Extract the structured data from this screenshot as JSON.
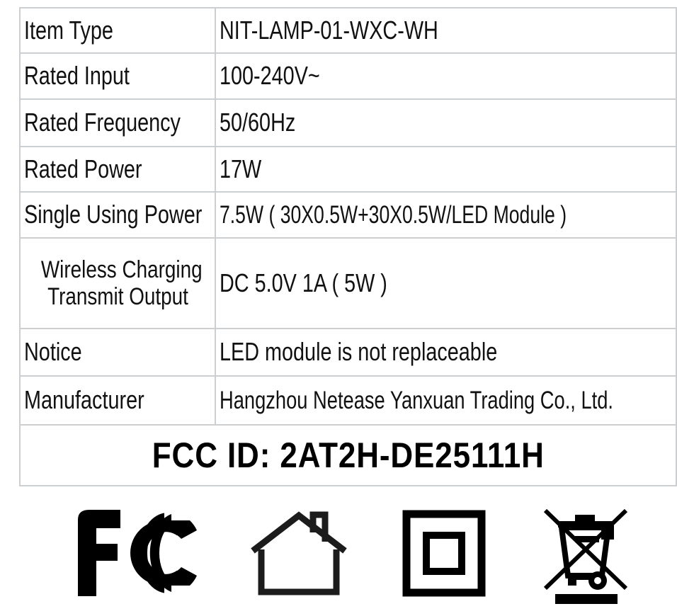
{
  "spec_table": {
    "rows": [
      {
        "label": "Item Type",
        "value": "NIT-LAMP-01-WXC-WH"
      },
      {
        "label": "Rated Input",
        "value": "100-240V~"
      },
      {
        "label": "Rated Frequency",
        "value": "50/60Hz"
      },
      {
        "label": "Rated Power",
        "value": "17W"
      },
      {
        "label": "Single Using Power",
        "value": "7.5W ( 30X0.5W+30X0.5W/LED Module )"
      },
      {
        "label_line1": "Wireless Charging",
        "label_line2": "Transmit Output",
        "value": "DC 5.0V    1A ( 5W )"
      },
      {
        "label": "Notice",
        "value": "LED module is not replaceable"
      },
      {
        "label": "Manufacturer",
        "value": "Hangzhou Netease Yanxuan Trading Co., Ltd."
      }
    ],
    "fcc_id": "FCC ID: 2AT2H-DE25111H",
    "border_color": "#cccfd1",
    "text_color": "#111111"
  },
  "compliance_icons": [
    {
      "name": "fcc-logo-icon",
      "title": "FCC"
    },
    {
      "name": "indoor-use-house-icon",
      "title": "Indoor use only"
    },
    {
      "name": "class-2-double-insulation-icon",
      "title": "Class II"
    },
    {
      "name": "weee-crossed-out-bin-icon",
      "title": "WEEE"
    }
  ]
}
